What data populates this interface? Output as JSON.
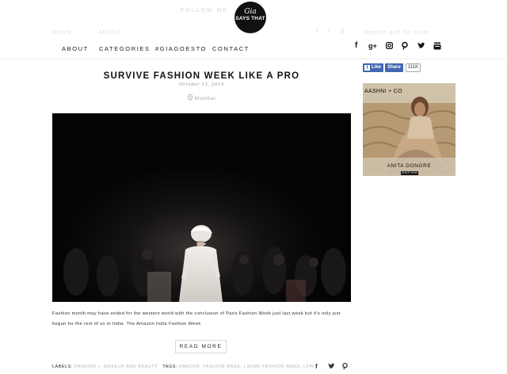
{
  "header": {
    "follow_text": "FOLLOW ME",
    "left_faded": [
      "HOME",
      "ABOUT"
    ],
    "logo_top": "Gia",
    "logo_bottom": "SAYS THAT",
    "search_placeholder": "Search and hit enter"
  },
  "nav": {
    "items": [
      "ABOUT",
      "CATEGORIES",
      "#GIAGOESTO",
      "CONTACT"
    ]
  },
  "social_icons": [
    "facebook-icon",
    "google-plus-icon",
    "instagram-icon",
    "pinterest-icon",
    "twitter-icon",
    "youtube-icon"
  ],
  "post": {
    "title": "SURVIVE FASHION WEEK LIKE A PRO",
    "date": "October 13, 2016",
    "location": "Mumbai",
    "excerpt": "Fashion month may have ended for the western world with the conclusion of Paris Fashion Week just last week but it's only just begun for the rest of us in India. The Amazon India Fashion Week",
    "read_more": "READ MORE",
    "labels_label": "LABELS:",
    "labels_value": "FASHION +, MAKEUP AND BEAUTY",
    "tags_label": "TAGS:",
    "tags_value": "AMAZON, FASHION WEEK, LAKME FASHION WEEK, LFW"
  },
  "sidebar": {
    "like_label": "Like",
    "share_label": "Share",
    "like_count": "111K",
    "ad_brand": "AASHNI + CO",
    "ad_name": "ANITA DONGRE",
    "ad_cta": "SHOP NOW"
  },
  "colors": {
    "facebook_blue": "#4267b2",
    "hero_bg": "#040404"
  }
}
